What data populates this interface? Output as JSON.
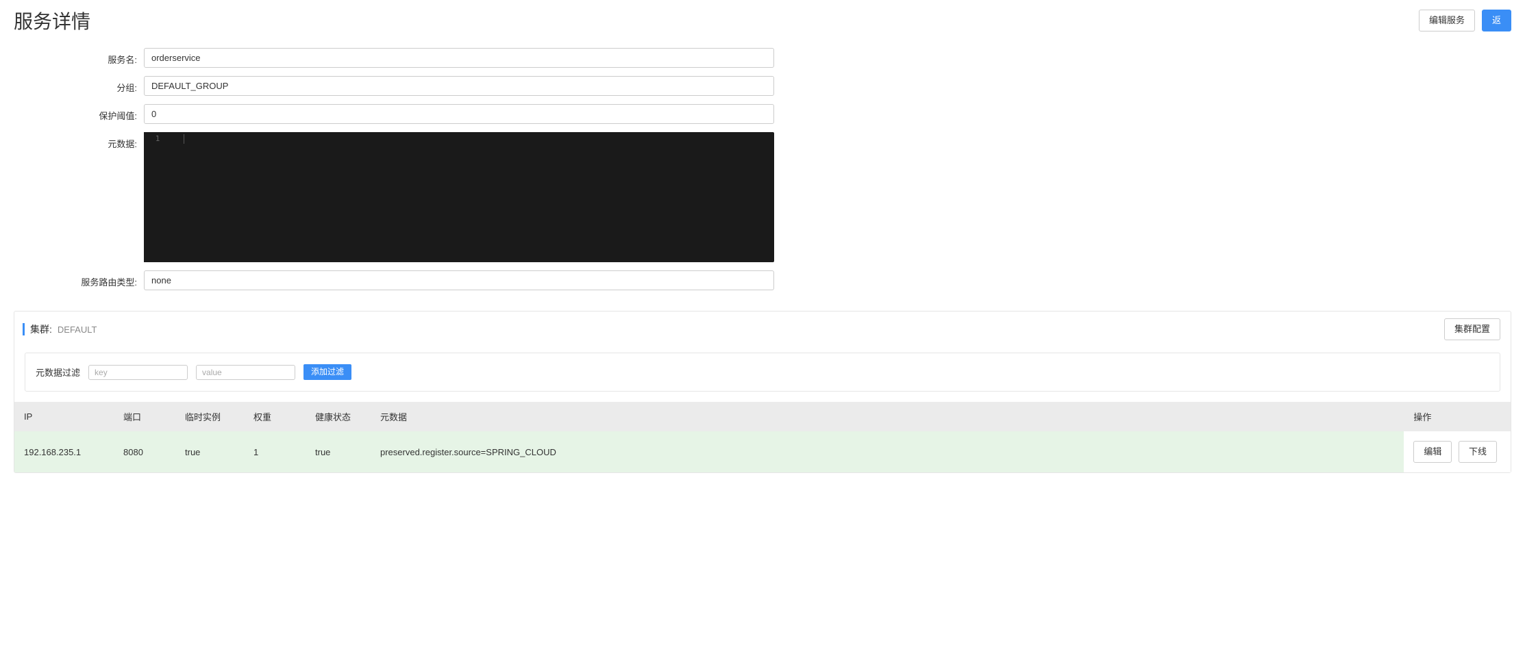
{
  "header": {
    "title": "服务详情",
    "edit_service_label": "编辑服务",
    "back_label": "返"
  },
  "form": {
    "service_name": {
      "label": "服务名:",
      "value": "orderservice"
    },
    "group": {
      "label": "分组:",
      "value": "DEFAULT_GROUP"
    },
    "protect_threshold": {
      "label": "保护阈值:",
      "value": "0"
    },
    "metadata": {
      "label": "元数据:",
      "line_number": "1",
      "content": ""
    },
    "route_type": {
      "label": "服务路由类型:",
      "value": "none"
    }
  },
  "cluster": {
    "title_label": "集群:",
    "name": "DEFAULT",
    "config_button_label": "集群配置"
  },
  "filter": {
    "label": "元数据过滤",
    "key_placeholder": "key",
    "value_placeholder": "value",
    "add_filter_label": "添加过滤"
  },
  "table": {
    "columns": {
      "ip": "IP",
      "port": "端口",
      "ephemeral": "临时实例",
      "weight": "权重",
      "health": "健康状态",
      "metadata": "元数据",
      "actions": "操作"
    },
    "rows": [
      {
        "ip": "192.168.235.1",
        "port": "8080",
        "ephemeral": "true",
        "weight": "1",
        "health": "true",
        "metadata": "preserved.register.source=SPRING_CLOUD"
      }
    ],
    "action_labels": {
      "edit": "编辑",
      "offline": "下线"
    }
  }
}
